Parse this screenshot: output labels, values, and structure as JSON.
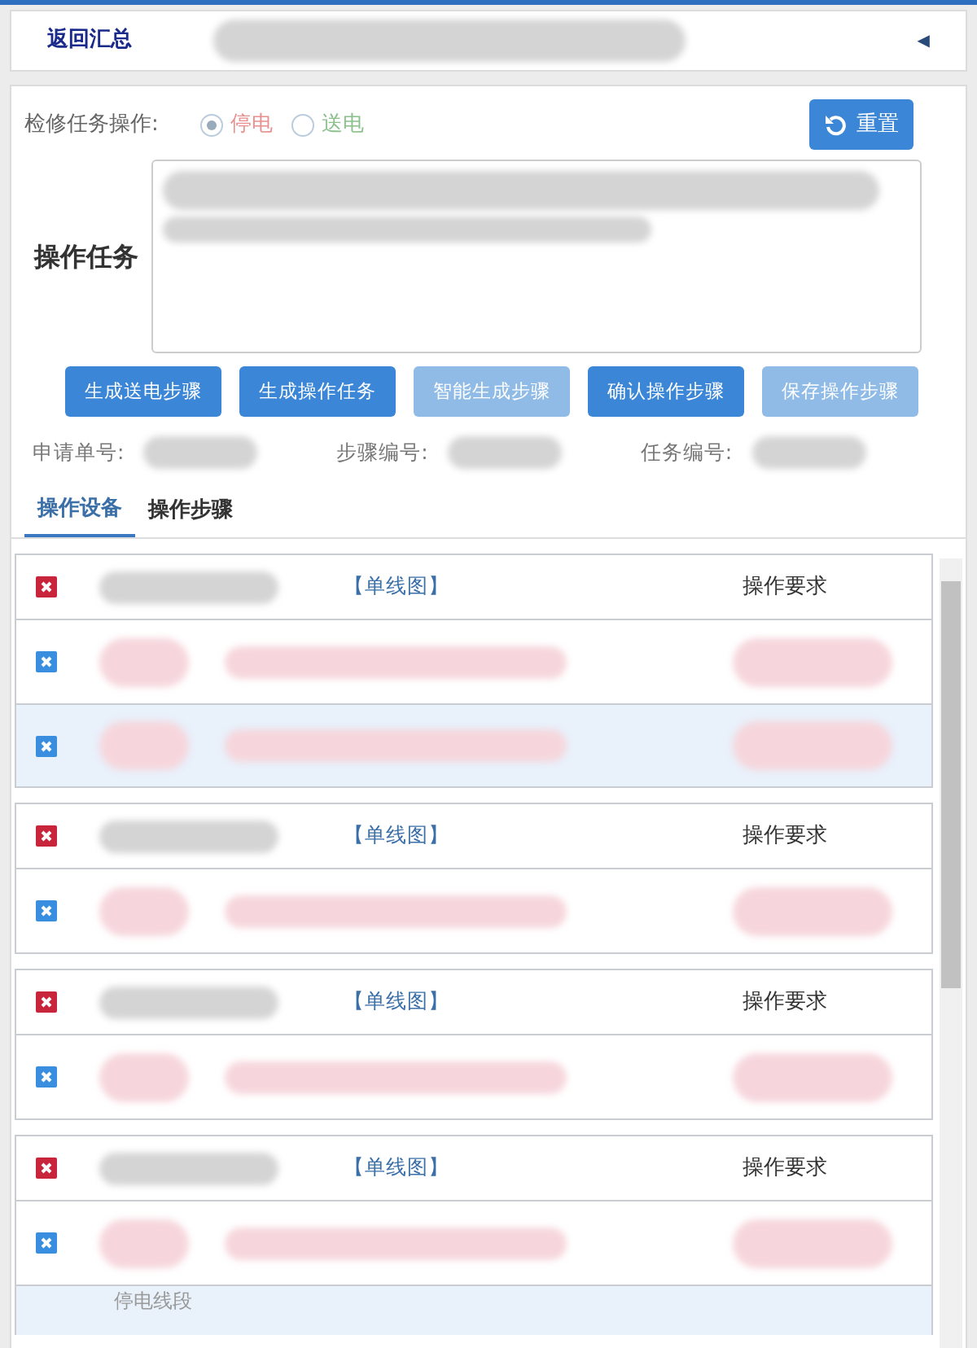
{
  "header": {
    "back_link": "返回汇总",
    "collapse_glyph": "◀"
  },
  "task_type": {
    "label": "检修任务操作:",
    "options": [
      {
        "label": "停电",
        "selected": true,
        "color": "#e89090"
      },
      {
        "label": "送电",
        "selected": false,
        "color": "#8cc08c"
      }
    ]
  },
  "reset_button": "重置",
  "task_field": {
    "label": "操作任务"
  },
  "actions": [
    {
      "label": "生成送电步骤",
      "disabled": false
    },
    {
      "label": "生成操作任务",
      "disabled": false
    },
    {
      "label": "智能生成步骤",
      "disabled": true
    },
    {
      "label": "确认操作步骤",
      "disabled": false
    },
    {
      "label": "保存操作步骤",
      "disabled": true
    }
  ],
  "info": [
    {
      "label": "申请单号:"
    },
    {
      "label": "步骤编号:"
    },
    {
      "label": "任务编号:"
    }
  ],
  "tabs": [
    {
      "label": "操作设备",
      "selected": true
    },
    {
      "label": "操作步骤",
      "selected": false
    }
  ],
  "groups": [
    {
      "diagram_link": "【单线图】",
      "requirement_heading": "操作要求",
      "rows": [
        {
          "selected": false
        },
        {
          "selected": true
        }
      ]
    },
    {
      "diagram_link": "【单线图】",
      "requirement_heading": "操作要求",
      "rows": [
        {
          "selected": false
        }
      ]
    },
    {
      "diagram_link": "【单线图】",
      "requirement_heading": "操作要求",
      "rows": [
        {
          "selected": false
        }
      ]
    },
    {
      "diagram_link": "【单线图】",
      "requirement_heading": "操作要求",
      "rows": [
        {
          "selected": false
        }
      ]
    }
  ],
  "partial_row": {
    "text": "停电线段"
  }
}
